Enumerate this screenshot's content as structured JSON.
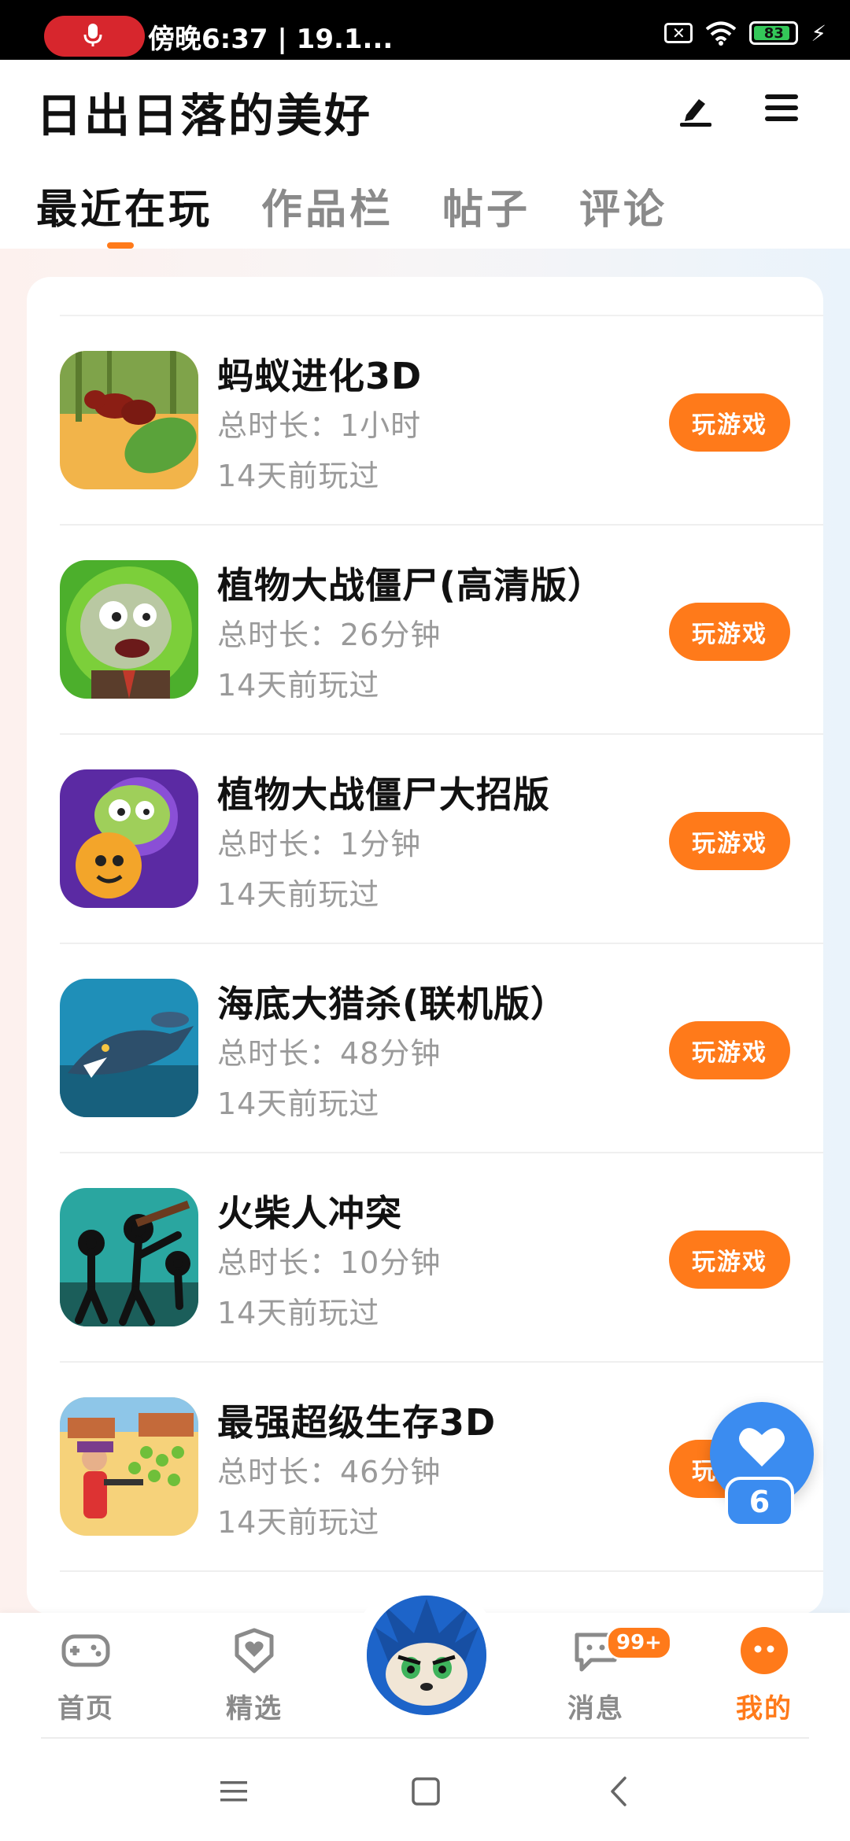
{
  "status_bar": {
    "text": "傍晚6:37 | 19.1...",
    "battery": "83"
  },
  "header": {
    "title": "日出日落的美好",
    "tabs": [
      "最近在玩",
      "作品栏",
      "帖子",
      "评论"
    ]
  },
  "games": [
    {
      "title": "蚂蚁进化3D",
      "duration": "总时长：1小时",
      "last_played": "14天前玩过",
      "button": "玩游戏",
      "icon": "ant-game-icon"
    },
    {
      "title": "植物大战僵尸(高清版）",
      "duration": "总时长：26分钟",
      "last_played": "14天前玩过",
      "button": "玩游戏",
      "icon": "zombie-game-icon"
    },
    {
      "title": "植物大战僵尸大招版",
      "duration": "总时长：1分钟",
      "last_played": "14天前玩过",
      "button": "玩游戏",
      "icon": "zombie-plant-game-icon"
    },
    {
      "title": "海底大猎杀(联机版）",
      "duration": "总时长：48分钟",
      "last_played": "14天前玩过",
      "button": "玩游戏",
      "icon": "shark-game-icon"
    },
    {
      "title": "火柴人冲突",
      "duration": "总时长：10分钟",
      "last_played": "14天前玩过",
      "button": "玩游戏",
      "icon": "stickman-game-icon"
    },
    {
      "title": "最强超级生存3D",
      "duration": "总时长：46分钟",
      "last_played": "14天前玩过",
      "button": "玩游戏",
      "icon": "survival-game-icon"
    }
  ],
  "like_fab": {
    "count": "6"
  },
  "bottom_nav": {
    "home": "首页",
    "featured": "精选",
    "messages": "消息",
    "messages_badge": "99+",
    "mine": "我的"
  },
  "colors": {
    "accent": "#ff7a1a",
    "fab": "#3b8cf0"
  }
}
